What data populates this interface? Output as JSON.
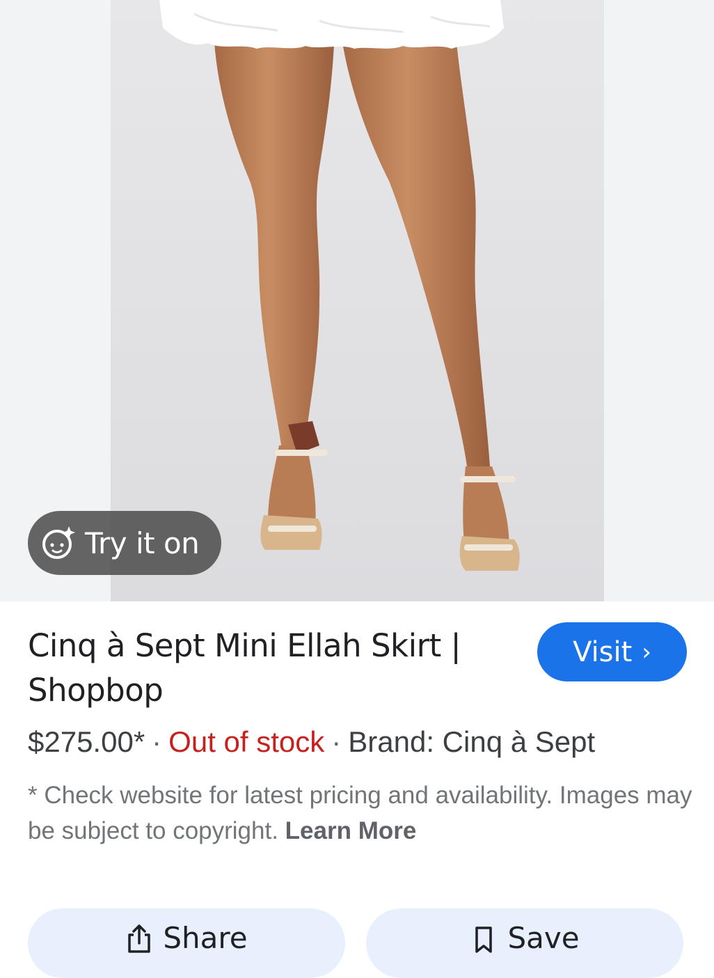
{
  "product": {
    "title": "Cinq à Sept Mini Ellah Skirt | Shopbop",
    "price": "$275.00*",
    "separator": "·",
    "stock_status": "Out of stock",
    "brand": "Brand: Cinq à Sept"
  },
  "try_on": {
    "label": "Try it on",
    "icon": "face-sparkle-icon"
  },
  "visit": {
    "label": "Visit",
    "icon": "chevron-right-icon"
  },
  "disclaimer": {
    "text": "* Check website for latest pricing and availability. Images may be subject to copyright. ",
    "learn_more": "Learn More"
  },
  "actions": {
    "share_label": "Share",
    "share_icon": "share-icon",
    "save_label": "Save",
    "save_icon": "bookmark-icon"
  },
  "colors": {
    "accent": "#1a73e8",
    "out_of_stock": "#c5221f",
    "action_bg": "#e8f0fe"
  }
}
